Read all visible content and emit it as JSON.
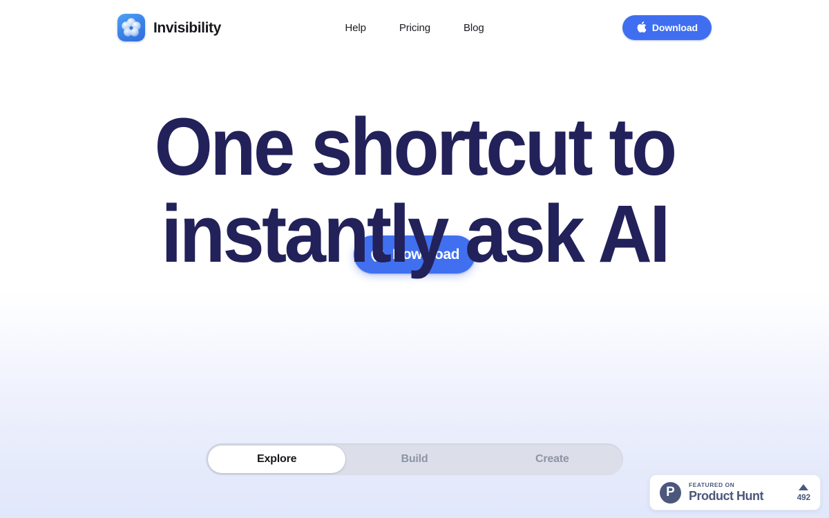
{
  "brand": {
    "name": "Invisibility",
    "logo_icon": "invisibility-flower-logo",
    "logo_bg": "#3b7fe8"
  },
  "nav": {
    "items": [
      {
        "label": "Help"
      },
      {
        "label": "Pricing"
      },
      {
        "label": "Blog"
      }
    ]
  },
  "header_cta": {
    "label": "Download",
    "icon": "apple-icon",
    "bg": "#3f6ff0"
  },
  "hero": {
    "headline_line1": "One shortcut to",
    "headline_line2": "instantly ask AI",
    "headline_color": "#222159",
    "cta": {
      "label": "Download",
      "icon": "apple-icon",
      "bg": "#4070ef"
    }
  },
  "tabs": {
    "items": [
      {
        "label": "Explore",
        "active": true
      },
      {
        "label": "Build",
        "active": false
      },
      {
        "label": "Create",
        "active": false
      }
    ],
    "track_bg": "#dcdfe9",
    "active_bg": "#ffffff"
  },
  "product_hunt": {
    "logo_letter": "P",
    "featured_label": "FEATURED ON",
    "title": "Product Hunt",
    "upvote_icon": "triangle-up-icon",
    "upvote_count": "492",
    "accent": "#4b587c"
  }
}
